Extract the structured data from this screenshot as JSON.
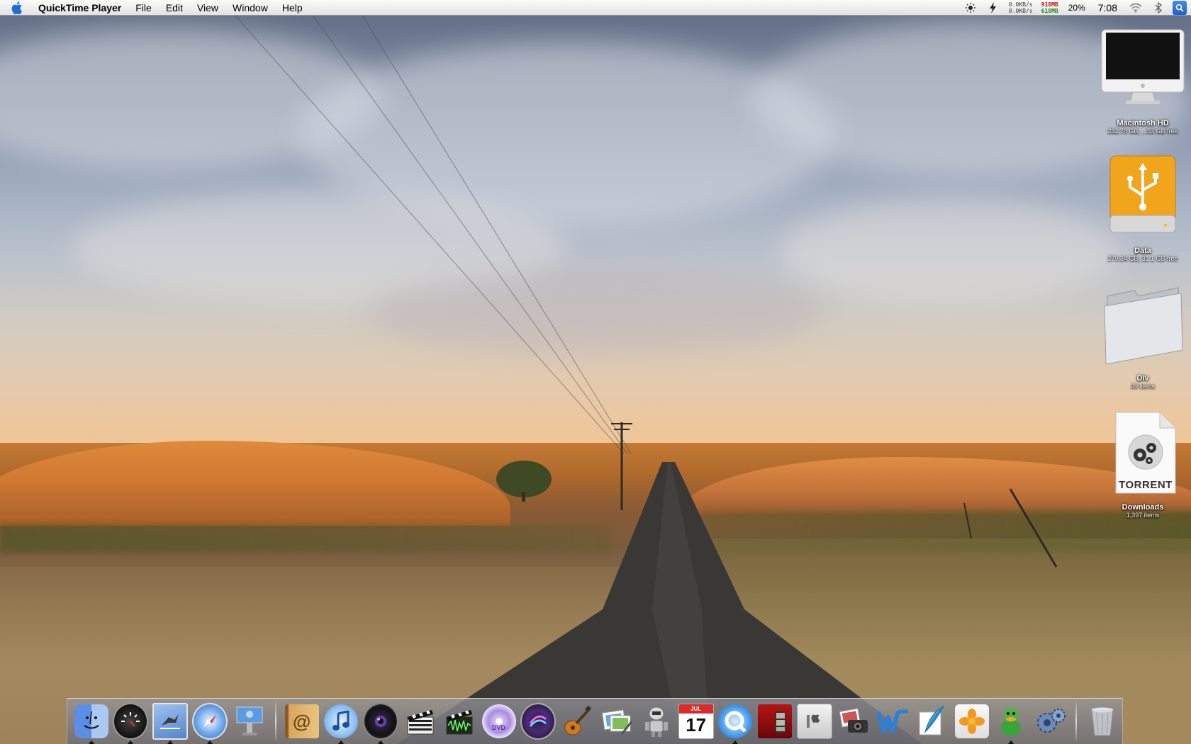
{
  "menubar": {
    "app_name": "QuickTime Player",
    "menus": [
      "File",
      "Edit",
      "View",
      "Window",
      "Help"
    ],
    "status": {
      "net_up": "0.0KB/s",
      "net_down": "0.0KB/s",
      "mem_used": "918MB",
      "mem_free": "618MB",
      "battery": "20%",
      "time": "7:08"
    }
  },
  "desktop_icons": [
    {
      "name": "Macintosh HD",
      "info": "232.76 GB, ...53 GB free",
      "icon": "imac-icon"
    },
    {
      "name": "Data",
      "info": "279.34 GB, 31.1 GB free",
      "icon": "usb-drive-icon"
    },
    {
      "name": "Div",
      "info": "39 items",
      "icon": "folder-icon"
    },
    {
      "name": "Downloads",
      "info": "1,397 items",
      "icon": "torrent-file-icon",
      "badge": "TORRENT"
    }
  ],
  "dock": {
    "items": [
      "Finder",
      "Dashboard",
      "Mail",
      "Safari",
      "Keynote",
      "Address Book",
      "iTunes",
      "Aperture",
      "Final Cut Pro",
      "Soundtrack Pro",
      "DVD Studio Pro",
      "Motion",
      "GarageBand",
      "Preview",
      "Automator",
      "iCal",
      "QuickTime Player",
      "Photo Booth",
      "Boot Camp",
      "Image Capture",
      "Word",
      "Scrivener",
      "iPhoto",
      "Adium",
      "Transmission",
      "Trash"
    ],
    "ical_day": "17",
    "ical_month": "JUL"
  },
  "colors": {
    "accent": "#1c5fc8",
    "mem_used": "#c21010",
    "mem_free": "#1a8a1a"
  }
}
